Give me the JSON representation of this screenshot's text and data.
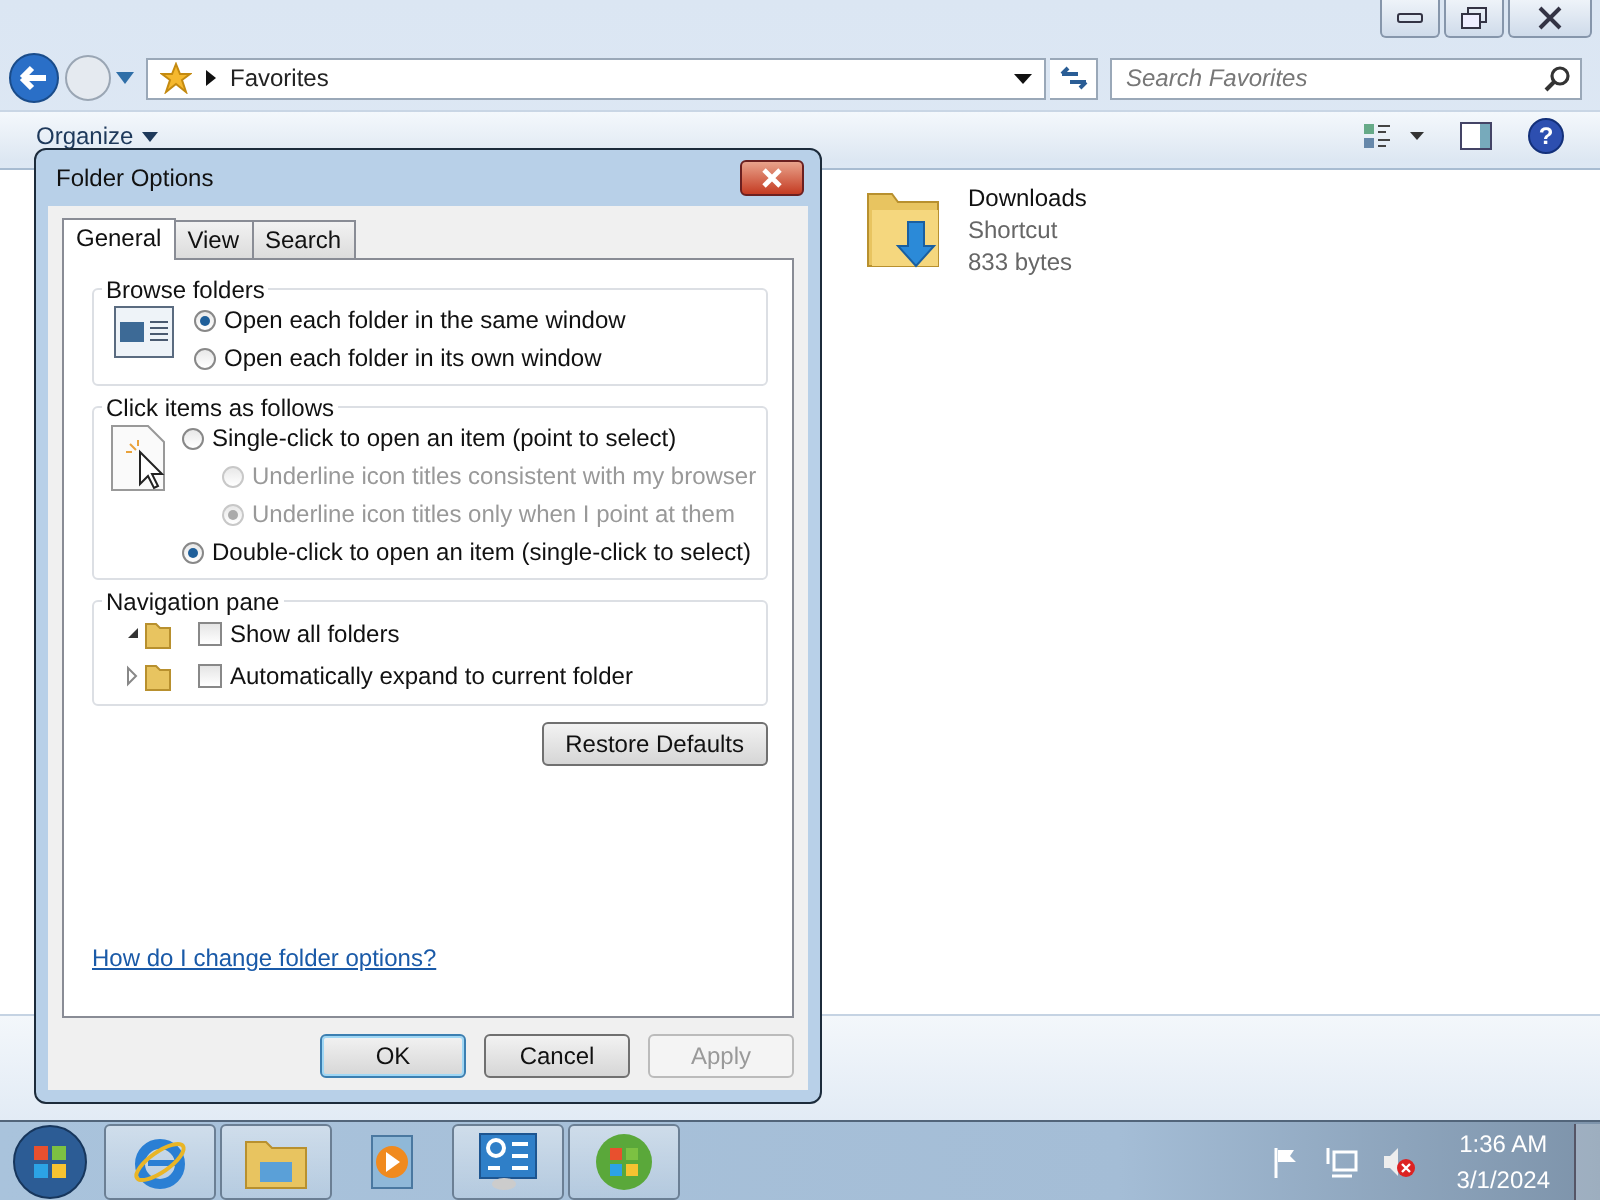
{
  "explorer": {
    "address": "Favorites",
    "search": {
      "placeholder": "Search Favorites"
    },
    "toolbar": {
      "organize": "Organize",
      "help": "?"
    },
    "items": [
      {
        "name": "Downloads",
        "type": "Shortcut",
        "size": "833 bytes"
      }
    ]
  },
  "dialog": {
    "title": "Folder Options",
    "tabs": [
      {
        "label": "General",
        "selected": true
      },
      {
        "label": "View",
        "selected": false
      },
      {
        "label": "Search",
        "selected": false
      }
    ],
    "groups": [
      {
        "title": "Browse folders",
        "kind": "radio",
        "options": [
          {
            "label": "Open each folder in the same window",
            "selected": true,
            "disabled": false
          },
          {
            "label": "Open each folder in its own window",
            "selected": false,
            "disabled": false
          }
        ]
      },
      {
        "title": "Click items as follows",
        "kind": "radio",
        "options": [
          {
            "label": "Single-click to open an item (point to select)",
            "selected": false,
            "disabled": false,
            "children": [
              {
                "label": "Underline icon titles consistent with my browser",
                "selected": false,
                "disabled": true
              },
              {
                "label": "Underline icon titles only when I point at them",
                "selected": true,
                "disabled": true
              }
            ]
          },
          {
            "label": "Double-click to open an item (single-click to select)",
            "selected": true,
            "disabled": false
          }
        ]
      },
      {
        "title": "Navigation pane",
        "kind": "checkbox",
        "options": [
          {
            "label": "Show all folders",
            "checked": false,
            "expanded": true
          },
          {
            "label": "Automatically expand to current folder",
            "checked": false,
            "expanded": false
          }
        ]
      }
    ],
    "restore": "Restore Defaults",
    "help_link": "How do I change folder options?",
    "buttons": [
      {
        "label": "OK",
        "default": true,
        "disabled": false
      },
      {
        "label": "Cancel",
        "default": false,
        "disabled": false
      },
      {
        "label": "Apply",
        "default": false,
        "disabled": true
      }
    ]
  },
  "taskbar": {
    "apps": [
      {
        "kind": "ie",
        "running": true
      },
      {
        "kind": "explorer",
        "running": true
      },
      {
        "kind": "media",
        "running": false
      },
      {
        "kind": "control",
        "running": true
      },
      {
        "kind": "windows",
        "running": true
      }
    ],
    "time": "1:36 AM",
    "date": "3/1/2024"
  }
}
